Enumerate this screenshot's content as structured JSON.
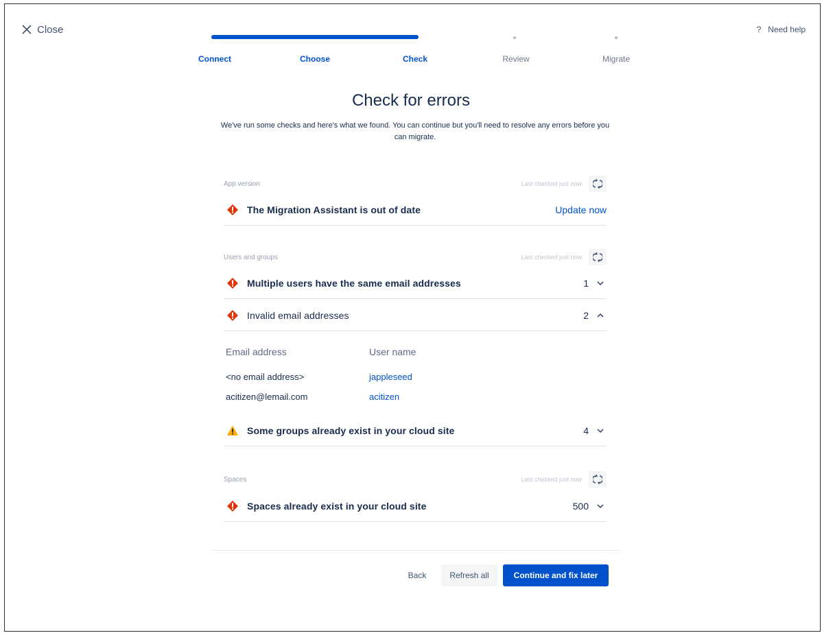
{
  "header": {
    "close_label": "Close",
    "help_label": "Need help",
    "help_glyph": "?"
  },
  "steps": [
    {
      "label": "Connect",
      "state": "done"
    },
    {
      "label": "Choose",
      "state": "done"
    },
    {
      "label": "Check",
      "state": "current"
    },
    {
      "label": "Review",
      "state": "todo"
    },
    {
      "label": "Migrate",
      "state": "todo"
    }
  ],
  "page": {
    "title": "Check for errors",
    "subtitle": "We've run some checks and here's what we found. You can continue but you'll need to resolve any errors before you can migrate."
  },
  "sections": {
    "app_version": {
      "name": "App version",
      "last_checked": "Last checked just now",
      "items": [
        {
          "severity": "error",
          "text": "The Migration Assistant is out of date",
          "action": "Update now"
        }
      ]
    },
    "users_groups": {
      "name": "Users and groups",
      "last_checked": "Last checked just now",
      "items": [
        {
          "severity": "error",
          "text": "Multiple users have the same email addresses",
          "count": "1",
          "expanded": false
        },
        {
          "severity": "error",
          "text": "Invalid email addresses",
          "count": "2",
          "expanded": true
        },
        {
          "severity": "warning",
          "text": "Some groups already exist in your cloud site",
          "count": "4",
          "expanded": false
        }
      ],
      "invalid_emails_table": {
        "headers": [
          "Email address",
          "User name"
        ],
        "rows": [
          [
            "<no email address>",
            "jappleseed"
          ],
          [
            "acitizen@lemail.com",
            "acitizen"
          ]
        ]
      }
    },
    "spaces": {
      "name": "Spaces",
      "last_checked": "Last checked just now",
      "items": [
        {
          "severity": "error",
          "text": "Spaces already exist in your cloud site",
          "count": "500",
          "expanded": false
        }
      ]
    }
  },
  "footer": {
    "back_label": "Back",
    "refresh_label": "Refresh all",
    "continue_label": "Continue and fix later"
  },
  "colors": {
    "accent": "#0052cc",
    "error": "#de350b",
    "warning": "#ffab00",
    "text": "#172b4d"
  }
}
